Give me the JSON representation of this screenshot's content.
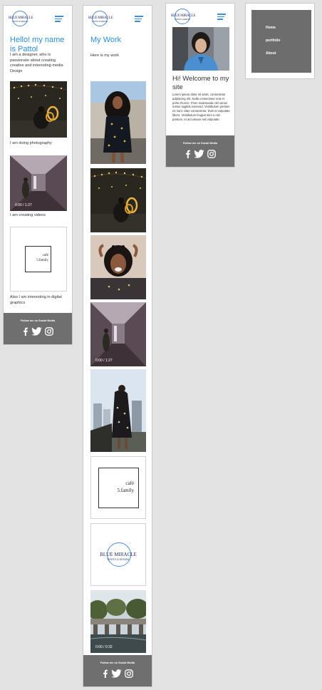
{
  "brand": {
    "name": "BLUE MIRACLE",
    "tagline": "PHOTO & DESIGN"
  },
  "screen_home": {
    "title": "Hello! my name is Pattol",
    "intro": "I am a designer, who is passionate about creating creative and interesting media Design",
    "photography": "I am doing photography",
    "videos": "I am creating videos",
    "video_time": "0:00 / 1:27",
    "graphics": "Also I am interesting in digital graphics"
  },
  "screen_work": {
    "title": "My Work",
    "subtitle": "Here is my work",
    "video_time_1": "0:00 / 1:27",
    "video_time_2": "0:00 / 0:32"
  },
  "screen_welcome": {
    "title": "Hi! Welcome to my site",
    "body": "Lorem ipsum dolor sit amet, consectetur adipiscing elit. Nulla consectetur erat et porta rhonco. Proin malesuada nisl varius metus sagittis euismod. Vestibulum pretium ex nunc vitae consectetur. Duis et vulputate libero. Vestibulum feugiat sem a nisl pretium, et accumsan nisl vulputate."
  },
  "cafe": {
    "line1": "café",
    "line2": "5.family"
  },
  "footer": {
    "label": "Follow me on Social Media"
  },
  "menu": {
    "items": [
      "Home",
      "portfolio",
      "About"
    ]
  },
  "colors": {
    "accent": "#2a8ed8",
    "footer": "#6f6f6f",
    "menu": "#6d6d6d"
  }
}
